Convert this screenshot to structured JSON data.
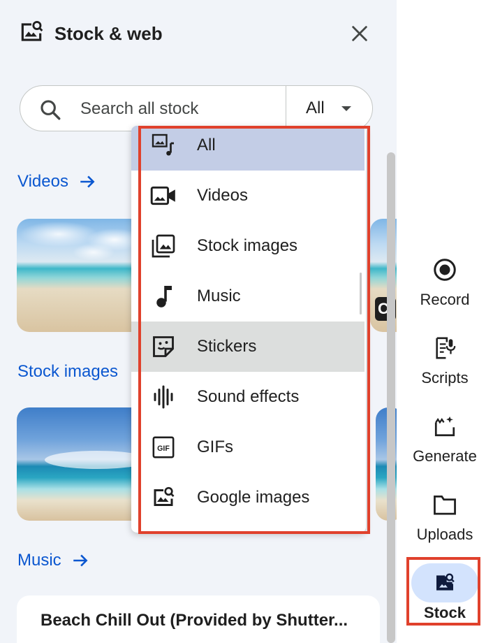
{
  "panel": {
    "title": "Stock & web",
    "search": {
      "placeholder": "Search all stock",
      "filter_value": "All"
    },
    "sections": [
      {
        "label": "Videos"
      },
      {
        "label": "Stock images"
      },
      {
        "label": "Music"
      }
    ],
    "music_card": {
      "title": "Beach Chill Out (Provided by Shutter..."
    },
    "video_badge": "C"
  },
  "dropdown": {
    "items": [
      {
        "label": "All",
        "icon": "all-media-icon",
        "state": "selected"
      },
      {
        "label": "Videos",
        "icon": "video-camera-icon",
        "state": ""
      },
      {
        "label": "Stock images",
        "icon": "image-library-icon",
        "state": ""
      },
      {
        "label": "Music",
        "icon": "music-note-icon",
        "state": ""
      },
      {
        "label": "Stickers",
        "icon": "sticker-icon",
        "state": "hovered"
      },
      {
        "label": "Sound effects",
        "icon": "waveform-icon",
        "state": ""
      },
      {
        "label": "GIFs",
        "icon": "gif-icon",
        "state": ""
      },
      {
        "label": "Google images",
        "icon": "image-search-icon",
        "state": ""
      }
    ]
  },
  "rail": {
    "items": [
      {
        "label": "Record",
        "icon": "record-icon",
        "active": false
      },
      {
        "label": "Scripts",
        "icon": "script-icon",
        "active": false
      },
      {
        "label": "Generate",
        "icon": "generate-icon",
        "active": false
      },
      {
        "label": "Uploads",
        "icon": "folder-icon",
        "active": false
      },
      {
        "label": "Stock",
        "icon": "image-search-icon",
        "active": true
      }
    ]
  },
  "colors": {
    "accent_link": "#0b57d0",
    "highlight_box": "#e0412c",
    "selected_item": "#c3cde6",
    "hovered_item": "#dcdedd",
    "active_rail_pill": "#d3e3fd"
  }
}
